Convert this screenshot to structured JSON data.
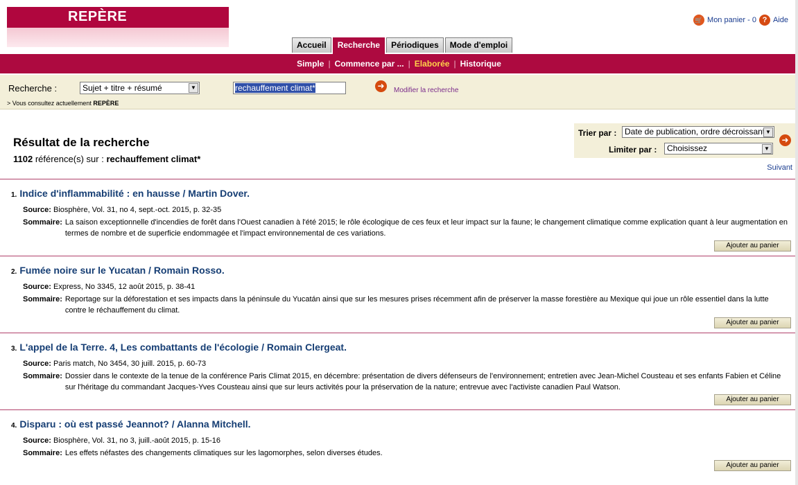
{
  "brand": {
    "logo_text": "REPÈRE"
  },
  "header": {
    "cart_label": "Mon panier - 0",
    "help_label": "Aide"
  },
  "tabs": [
    {
      "label": "Accueil",
      "active": false
    },
    {
      "label": "Recherche",
      "active": true
    },
    {
      "label": "Périodiques",
      "active": false
    },
    {
      "label": "Mode d'emploi",
      "active": false
    }
  ],
  "subnav": [
    {
      "label": "Simple",
      "current": false
    },
    {
      "label": "Commence par ...",
      "current": false
    },
    {
      "label": "Elaborée",
      "current": true
    },
    {
      "label": "Historique",
      "current": false
    }
  ],
  "search": {
    "label": "Recherche :",
    "field": "Sujet + titre + résumé",
    "query": "rechauffement climat*",
    "modify_label": "Modifier la recherche",
    "current_db_prefix": "> Vous consultez actuellement",
    "current_db": "REPÈRE"
  },
  "results_header": {
    "title": "Résultat de la recherche",
    "count": "1102",
    "count_suffix": "référence(s) sur :",
    "query": "rechauffement climat*"
  },
  "sort": {
    "sort_label": "Trier par :",
    "sort_value": "Date de publication, ordre décroissant",
    "limit_label": "Limiter par :",
    "limit_value": "Choisissez",
    "next_label": "Suivant"
  },
  "labels": {
    "source": "Source:",
    "summary": "Sommaire:",
    "add_to_cart": "Ajouter au panier"
  },
  "records": [
    {
      "num": "1.",
      "title": "Indice d'inflammabilité : en hausse / Martin Dover.",
      "source": "Biosphère, Vol. 31, no 4, sept.-oct. 2015, p. 32-35",
      "summary": "La saison exceptionnelle d'incendies de forêt dans l'Ouest canadien à l'été 2015; le rôle écologique de ces feux et leur impact sur la faune; le changement climatique comme explication quant à leur augmentation en termes de nombre et de superficie endommagée et l'impact environnemental de ces variations."
    },
    {
      "num": "2.",
      "title": "Fumée noire sur le Yucatan / Romain Rosso.",
      "source": "Express, No 3345, 12 août 2015, p. 38-41",
      "summary": "Reportage sur la déforestation et ses impacts dans la péninsule du Yucatán ainsi que sur les mesures prises récemment afin de préserver la masse forestière au Mexique qui joue un rôle essentiel dans la lutte contre le réchauffement du climat."
    },
    {
      "num": "3.",
      "title": "L'appel de la Terre. 4, Les combattants de l'écologie / Romain Clergeat.",
      "source": "Paris match, No 3454, 30 juill. 2015, p. 60-73",
      "summary": "Dossier dans le contexte de la tenue de la conférence Paris Climat 2015, en décembre: présentation de divers défenseurs de l'environnement; entretien avec Jean-Michel Cousteau et ses enfants Fabien et Céline sur l'héritage du commandant Jacques-Yves Cousteau ainsi que sur leurs activités pour la préservation de la nature; entrevue avec l'activiste canadien Paul Watson."
    },
    {
      "num": "4.",
      "title": "Disparu : où est passé Jeannot? / Alanna Mitchell.",
      "source": "Biosphère, Vol. 31, no 3, juill.-août 2015, p. 15-16",
      "summary": "Les effets néfastes des changements climatiques sur les lagomorphes, selon diverses études."
    }
  ]
}
